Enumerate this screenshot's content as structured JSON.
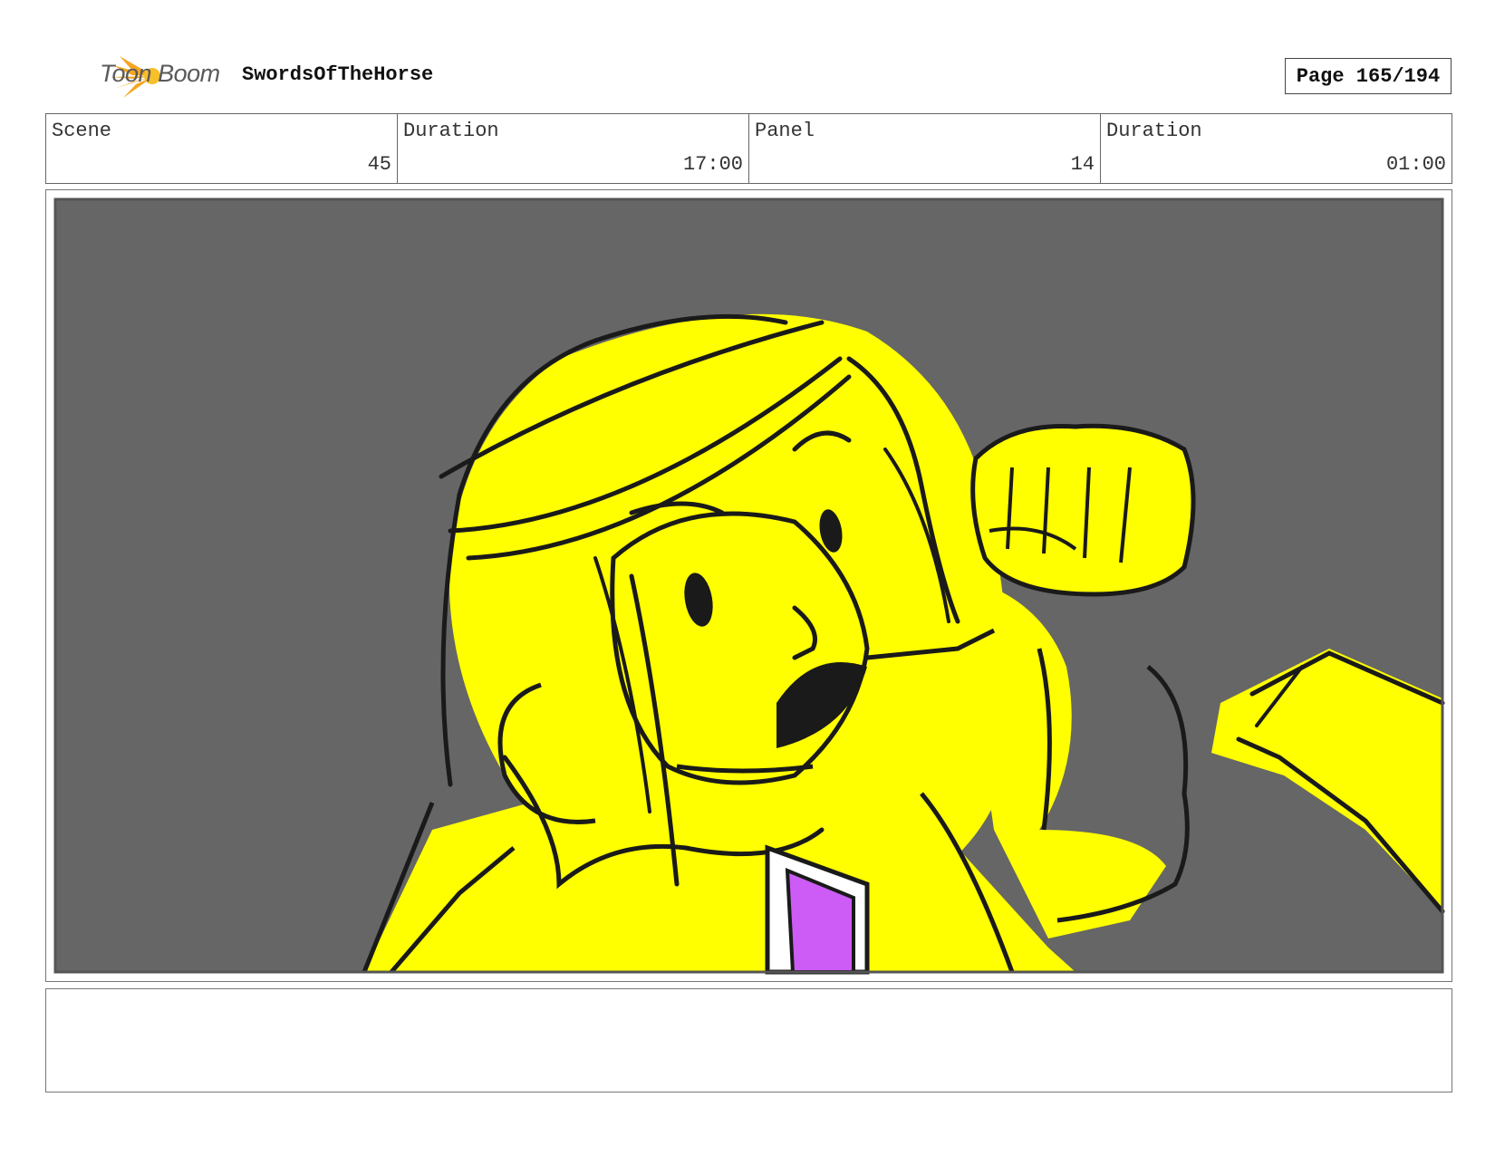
{
  "header": {
    "logo_text": "Toon Boom",
    "project_title": "SwordsOfTheHorse",
    "page_label": "Page 165/194"
  },
  "info": {
    "scene_label": "Scene",
    "scene_value": "45",
    "scene_duration_label": "Duration",
    "scene_duration_value": "17:00",
    "panel_label": "Panel",
    "panel_value": "14",
    "panel_duration_label": "Duration",
    "panel_duration_value": "01:00"
  },
  "notes": {
    "text": ""
  },
  "colors": {
    "background_gray": "#666666",
    "fill_yellow": "#ffff00",
    "accent_purple": "#cc5cf5",
    "logo_orange": "#f5a623",
    "ink": "#1a1a1a"
  },
  "icons": {
    "logo": "toon-boom-starburst-icon"
  }
}
